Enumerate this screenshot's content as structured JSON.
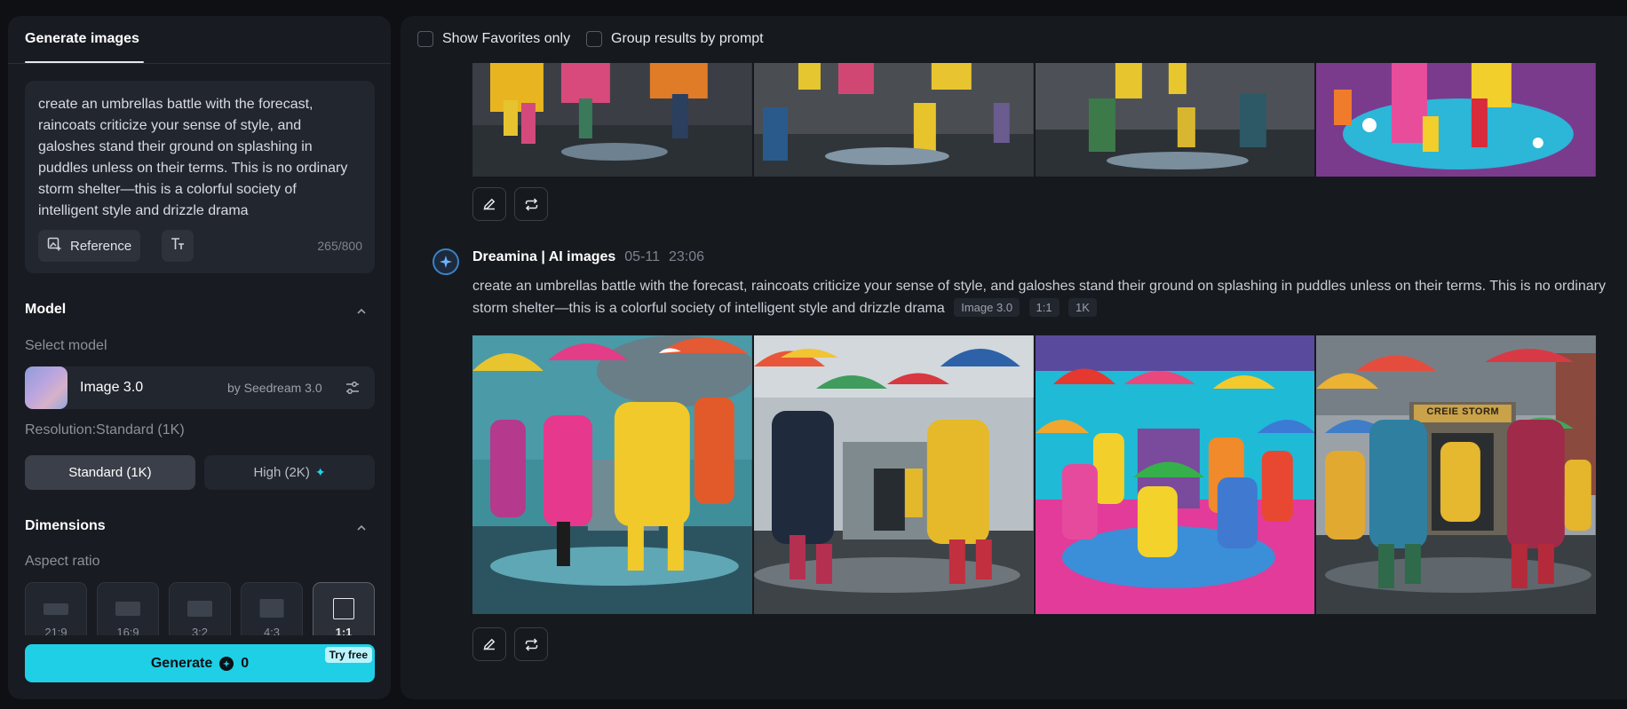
{
  "left_panel": {
    "tab_label": "Generate images",
    "prompt_text": "create an umbrellas battle with the forecast, raincoats criticize your sense of style, and galoshes stand their ground on splashing in puddles unless on their terms. This is no ordinary storm shelter—this is a colorful society of intelligent style and drizzle drama",
    "reference_label": "Reference",
    "char_counter": "265/800",
    "model_section": "Model",
    "select_model_label": "Select model",
    "model_name": "Image 3.0",
    "model_by": "by Seedream 3.0",
    "resolution_label": "Resolution:Standard (1K)",
    "res_standard": "Standard (1K)",
    "res_high": "High (2K)",
    "dimensions_section": "Dimensions",
    "aspect_ratio_label": "Aspect ratio",
    "aspect_ratios": [
      "21:9",
      "16:9",
      "3:2",
      "4:3",
      "1:1"
    ],
    "selected_ratio": "1:1",
    "generate_label": "Generate",
    "generate_cost": "0",
    "try_free": "Try free"
  },
  "right_panel": {
    "filter_favorites": "Show Favorites only",
    "filter_group": "Group results by prompt",
    "generation": {
      "author": "Dreamina | AI images",
      "date": "05-11",
      "time": "23:06",
      "prompt": "create an umbrellas battle with the forecast, raincoats criticize your sense of style, and galoshes stand their ground on splashing in puddles unless on their terms. This is no ordinary storm shelter—this is a colorful society of intelligent style and drizzle drama",
      "chip_model": "Image 3.0",
      "chip_ratio": "1:1",
      "chip_res": "1K"
    }
  },
  "colors": {
    "accent": "#1fcfe6",
    "panel": "#181b21",
    "background": "#0e1014"
  },
  "icons": {
    "edit": "pencil-icon",
    "regenerate": "repeat-icon",
    "reference": "image-add-icon",
    "text_style": "text-size-icon",
    "model_settings": "sliders-icon",
    "collapse": "chevron-up-icon",
    "bot": "dreamina-star-icon"
  }
}
